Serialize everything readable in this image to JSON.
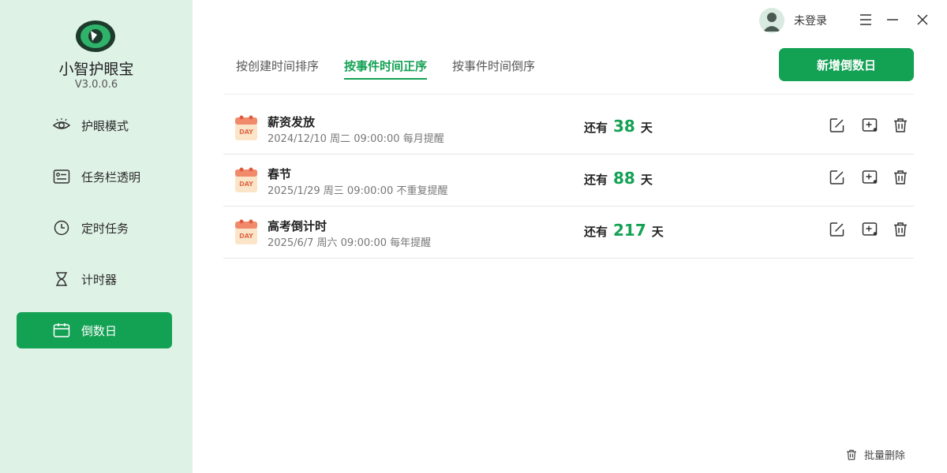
{
  "app": {
    "name": "小智护眼宝",
    "version": "V3.0.0.6"
  },
  "colors": {
    "accent": "#13a154",
    "sidebar_bg": "#dff2e6"
  },
  "sidebar": {
    "items": [
      {
        "label": "护眼模式",
        "icon": "eye-icon",
        "active": false
      },
      {
        "label": "任务栏透明",
        "icon": "taskbar-icon",
        "active": false
      },
      {
        "label": "定时任务",
        "icon": "clock-icon",
        "active": false
      },
      {
        "label": "计时器",
        "icon": "hourglass-icon",
        "active": false
      },
      {
        "label": "倒数日",
        "icon": "calendar-icon",
        "active": true
      }
    ]
  },
  "user": {
    "name": "未登录"
  },
  "tabs": [
    {
      "label": "按创建时间排序",
      "active": false
    },
    {
      "label": "按事件时间正序",
      "active": true
    },
    {
      "label": "按事件时间倒序",
      "active": false
    }
  ],
  "toolbar": {
    "add_label": "新增倒数日"
  },
  "countdown_prefix": "还有",
  "countdown_suffix": "天",
  "events": [
    {
      "title": "薪资发放",
      "meta": "2024/12/10 周二 09:00:00 每月提醒",
      "days": "38"
    },
    {
      "title": "春节",
      "meta": "2025/1/29 周三 09:00:00 不重复提醒",
      "days": "88"
    },
    {
      "title": "高考倒计时",
      "meta": "2025/6/7 周六 09:00:00 每年提醒",
      "days": "217"
    }
  ],
  "footer": {
    "batch_delete_label": "批量删除"
  },
  "calendar_icon_text": "DAY"
}
